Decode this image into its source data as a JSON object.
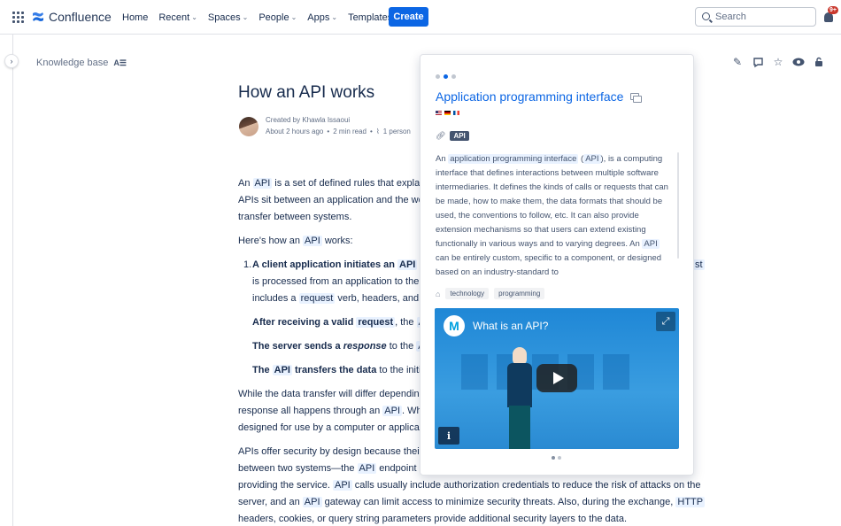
{
  "header": {
    "app_name": "Confluence",
    "nav": [
      {
        "label": "Home",
        "dropdown": false
      },
      {
        "label": "Recent",
        "dropdown": true
      },
      {
        "label": "Spaces",
        "dropdown": true
      },
      {
        "label": "People",
        "dropdown": true
      },
      {
        "label": "Apps",
        "dropdown": true
      },
      {
        "label": "Templates",
        "dropdown": false
      }
    ],
    "create_label": "Create",
    "search_placeholder": "Search",
    "notification_badge": "9+"
  },
  "breadcrumb": {
    "space": "Knowledge base"
  },
  "page": {
    "title": "How an API works",
    "created_by": "Created by Khawla Issaoui",
    "updated": "About 2 hours ago",
    "read_time": "2 min read",
    "viewers": "1 person",
    "p1_a": "An ",
    "p1_b": "API",
    "p1_c": " is a set of defined rules that explain",
    "p1_line2": "APIs sit between an application and the we",
    "p1_line3": "transfer between systems.",
    "p2_a": "Here's how an ",
    "p2_b": "API",
    "p2_c": " works:",
    "li1_num": "1.",
    "li1_a": "A client application initiates an ",
    "li1_b": "API",
    "li1_c": " c",
    "li1_tail": "st",
    "li1_line2": "is processed from an application to the",
    "li1_line3_a": "includes a ",
    "li1_line3_b": "request",
    "li1_line3_c": " verb, headers, and s",
    "li2_a": "After receiving a valid ",
    "li2_b": "request",
    "li2_c": ", the ",
    "li2_d": "A",
    "li3_a": "The server sends a ",
    "li3_b": "response",
    "li3_c": " to the ",
    "li3_d": "AP",
    "li4_a": "The ",
    "li4_b": "API",
    "li4_c": " transfers the data",
    "li4_d": " to the initi",
    "p3_line1": "While the data transfer will differ dependin",
    "p3_line2_a": "response all happens through an ",
    "p3_line2_b": "API",
    "p3_line2_c": ". Whe",
    "p3_line3": "designed for use by a computer or applicat",
    "p4_line1": "APIs offer security by design because their",
    "p4_line2_a": "between two systems—the ",
    "p4_line2_b": "API",
    "p4_line2_c": " endpoint c",
    "p4_line3": "providing the service. ",
    "p4_line3_b": "API",
    "p4_line3_c": " calls usually include authorization credentials to reduce the risk of attacks on the",
    "p4_line4_a": "server, and an ",
    "p4_line4_b": "API",
    "p4_line4_c": " gateway can limit access to minimize security threats. Also, during the exchange, ",
    "p4_line4_d": "HTTP",
    "p4_line5": "headers, cookies, or query string parameters provide additional security layers to the data."
  },
  "popup": {
    "title": "Application programming interface",
    "alias": "API",
    "desc_a": "An ",
    "desc_b": "application programming interface",
    "desc_c": " (",
    "desc_d": "API",
    "desc_e": "), is a computing interface that defines interactions between multiple software intermediaries. It defines the kinds of calls or requests that can be made, how to make them, the data formats that should be used, the conventions to follow, etc. It can also provide extension mechanisms so that users can extend existing functionally in various ways and to varying degrees. An ",
    "desc_f": "API",
    "desc_g": " can be entirely custom, specific to a component, or designed based on an industry-standard to",
    "tags": [
      "technology",
      "programming"
    ],
    "video_title": "What is an API?",
    "video_logo": "M",
    "info_label": "i"
  },
  "colors": {
    "accent": "#0c66e4",
    "highlight": "#e9f2ff",
    "text": "#172b4d"
  }
}
